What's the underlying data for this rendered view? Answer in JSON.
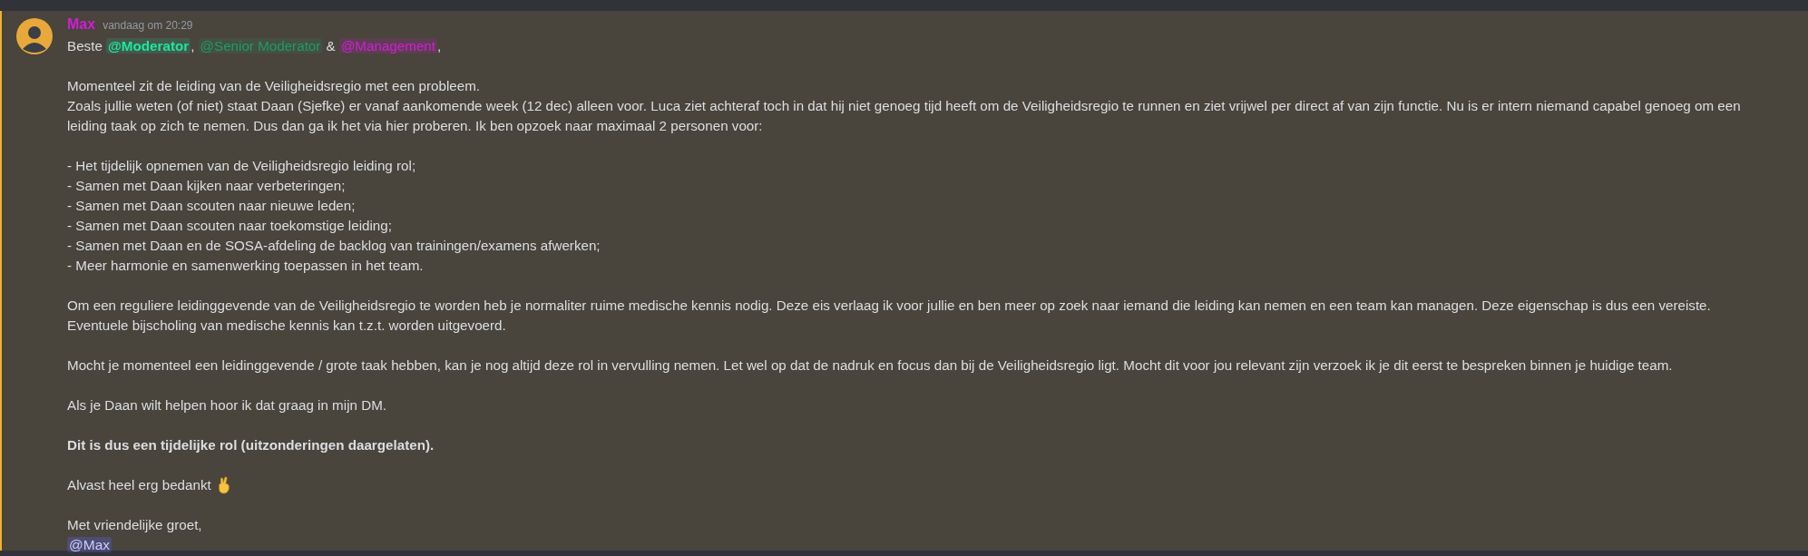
{
  "message": {
    "author": {
      "name": "Max",
      "color": "#d41cd8"
    },
    "timestamp": "vandaag om 20:29",
    "highlighted": true,
    "greeting": [
      {
        "kind": "text",
        "text": "Beste "
      },
      {
        "kind": "mention",
        "text": "@Moderator",
        "color": "#1ee6a0",
        "bold": true
      },
      {
        "kind": "text",
        "text": ", "
      },
      {
        "kind": "mention",
        "text": "@Senior Moderator",
        "color": "#1f9b68",
        "bold": false
      },
      {
        "kind": "text",
        "text": " & "
      },
      {
        "kind": "mention",
        "text": "@Management",
        "color": "#d41cd8",
        "bold": false
      },
      {
        "kind": "text",
        "text": ","
      }
    ],
    "blocks": [
      {
        "kind": "lines",
        "lines": [
          "Momenteel zit de leiding van de Veiligheidsregio met een probleem.",
          "Zoals jullie weten (of niet) staat Daan (Sjefke) er vanaf aankomende week (12 dec) alleen voor. Luca ziet achteraf toch in dat hij niet genoeg tijd heeft om de Veiligheidsregio te runnen en ziet vrijwel per direct af van zijn functie. Nu is er intern niemand capabel genoeg om een leiding taak op zich te nemen. Dus dan ga ik het via hier proberen. Ik ben opzoek naar maximaal 2 personen voor:"
        ]
      },
      {
        "kind": "lines",
        "lines": [
          "- Het tijdelijk opnemen van de Veiligheidsregio leiding rol;",
          "- Samen met Daan kijken naar verbeteringen;",
          "- Samen met Daan scouten naar nieuwe leden;",
          "- Samen met Daan scouten naar toekomstige leiding;",
          "- Samen met Daan en de SOSA-afdeling de backlog van trainingen/examens afwerken;",
          "- Meer harmonie en samenwerking toepassen in het team."
        ]
      },
      {
        "kind": "lines",
        "lines": [
          "Om een reguliere leidinggevende van de Veiligheidsregio te worden heb je normaliter ruime medische kennis nodig. Deze eis verlaag ik voor jullie en ben meer op zoek naar iemand die leiding kan nemen en een team kan managen. Deze eigenschap is dus een vereiste. Eventuele bijscholing van medische kennis kan t.z.t. worden uitgevoerd."
        ]
      },
      {
        "kind": "lines",
        "lines": [
          "Mocht je momenteel een leidinggevende / grote taak hebben, kan je nog altijd deze rol in vervulling nemen. Let wel op dat de nadruk en focus dan bij de Veiligheidsregio ligt. Mocht dit voor jou relevant zijn verzoek ik je dit eerst te bespreken binnen je huidige team."
        ]
      },
      {
        "kind": "lines",
        "lines": [
          "Als je Daan wilt helpen hoor ik dat graag in mijn DM."
        ]
      },
      {
        "kind": "bold",
        "text": "Dit is dus een tijdelijke rol (uitzonderingen daargelaten)."
      },
      {
        "kind": "emoji",
        "text": "Alvast heel erg bedankt"
      },
      {
        "kind": "signature",
        "text": "Met vriendelijke groet,",
        "mention": "@Max"
      }
    ]
  }
}
